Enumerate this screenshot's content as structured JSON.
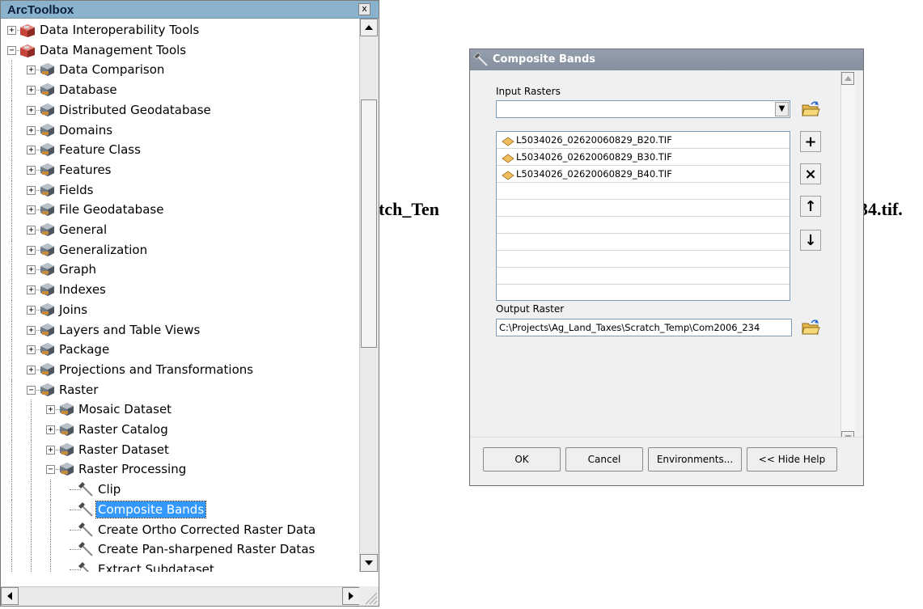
{
  "background": {
    "text_left": "tch_Ten",
    "text_right": "34.tif."
  },
  "toolbox": {
    "title": "ArcToolbox",
    "close_glyph": "x",
    "items": [
      {
        "label": "Data Interoperability Tools",
        "level": 0,
        "expanded": false,
        "icon": "toolbox-icon"
      },
      {
        "label": "Data Management Tools",
        "level": 0,
        "expanded": true,
        "icon": "toolbox-icon"
      },
      {
        "label": "Data Comparison",
        "level": 1,
        "expanded": false,
        "icon": "toolset-icon"
      },
      {
        "label": "Database",
        "level": 1,
        "expanded": false,
        "icon": "toolset-icon"
      },
      {
        "label": "Distributed Geodatabase",
        "level": 1,
        "expanded": false,
        "icon": "toolset-icon"
      },
      {
        "label": "Domains",
        "level": 1,
        "expanded": false,
        "icon": "toolset-icon"
      },
      {
        "label": "Feature Class",
        "level": 1,
        "expanded": false,
        "icon": "toolset-icon"
      },
      {
        "label": "Features",
        "level": 1,
        "expanded": false,
        "icon": "toolset-icon"
      },
      {
        "label": "Fields",
        "level": 1,
        "expanded": false,
        "icon": "toolset-icon"
      },
      {
        "label": "File Geodatabase",
        "level": 1,
        "expanded": false,
        "icon": "toolset-icon"
      },
      {
        "label": "General",
        "level": 1,
        "expanded": false,
        "icon": "toolset-icon"
      },
      {
        "label": "Generalization",
        "level": 1,
        "expanded": false,
        "icon": "toolset-icon"
      },
      {
        "label": "Graph",
        "level": 1,
        "expanded": false,
        "icon": "toolset-icon"
      },
      {
        "label": "Indexes",
        "level": 1,
        "expanded": false,
        "icon": "toolset-icon"
      },
      {
        "label": "Joins",
        "level": 1,
        "expanded": false,
        "icon": "toolset-icon"
      },
      {
        "label": "Layers and Table Views",
        "level": 1,
        "expanded": false,
        "icon": "toolset-icon"
      },
      {
        "label": "Package",
        "level": 1,
        "expanded": false,
        "icon": "toolset-icon"
      },
      {
        "label": "Projections and Transformations",
        "level": 1,
        "expanded": false,
        "icon": "toolset-icon"
      },
      {
        "label": "Raster",
        "level": 1,
        "expanded": true,
        "icon": "toolset-icon"
      },
      {
        "label": "Mosaic Dataset",
        "level": 2,
        "expanded": false,
        "icon": "toolset-icon"
      },
      {
        "label": "Raster Catalog",
        "level": 2,
        "expanded": false,
        "icon": "toolset-icon"
      },
      {
        "label": "Raster Dataset",
        "level": 2,
        "expanded": false,
        "icon": "toolset-icon"
      },
      {
        "label": "Raster Processing",
        "level": 2,
        "expanded": true,
        "icon": "toolset-icon"
      },
      {
        "label": "Clip",
        "level": 3,
        "icon": "hammer-icon"
      },
      {
        "label": "Composite Bands",
        "level": 3,
        "icon": "hammer-icon",
        "selected": true
      },
      {
        "label": "Create Ortho Corrected Raster Data",
        "level": 3,
        "icon": "hammer-icon"
      },
      {
        "label": "Create Pan-sharpened Raster Datas",
        "level": 3,
        "icon": "hammer-icon"
      },
      {
        "label": "Extract Subdataset",
        "level": 3,
        "icon": "hammer-icon"
      }
    ]
  },
  "dialog": {
    "title": "Composite Bands",
    "input_rasters_label": "Input Rasters",
    "input_rasters_value": "",
    "rasters": [
      "L5034026_02620060829_B20.TIF",
      "L5034026_02620060829_B30.TIF",
      "L5034026_02620060829_B40.TIF"
    ],
    "side_buttons": {
      "add": "+",
      "remove": "×",
      "up": "↑",
      "down": "↓"
    },
    "output_raster_label": "Output Raster",
    "output_raster_value": "C:\\Projects\\Ag_Land_Taxes\\Scratch_Temp\\Com2006_234",
    "buttons": {
      "ok": "OK",
      "cancel": "Cancel",
      "environments": "Environments...",
      "hide_help": "<< Hide Help"
    }
  },
  "colors": {
    "toolbox_title_bg": "#8bb2cc",
    "dialog_title_bg": "#8d98a6",
    "selection": "#3399ff",
    "raster_icon": "#f0c060"
  }
}
